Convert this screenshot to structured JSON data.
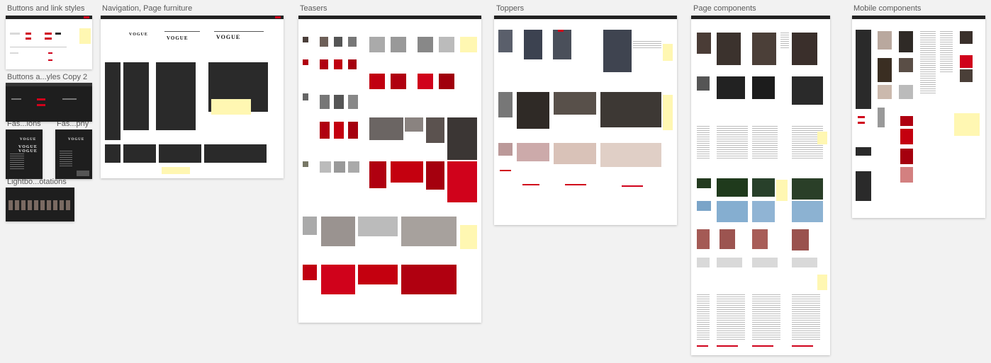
{
  "artboards": [
    {
      "title": "Buttons and link styles"
    },
    {
      "title": "Navigation, Page furniture"
    },
    {
      "title": "Teasers"
    },
    {
      "title": "Toppers"
    },
    {
      "title": "Page components"
    },
    {
      "title": "Mobile components"
    },
    {
      "title": "Buttons a...yles Copy 2"
    },
    {
      "title": "Fas...ions"
    },
    {
      "title": "Fas...phy"
    },
    {
      "title": "Lightbo...otations"
    }
  ],
  "colors": {
    "canvas": "#f2f2f2",
    "board": "#ffffff",
    "dark_board": "#1e1e1e",
    "accent_red": "#d0021b",
    "sticky_note": "#fff7b2"
  }
}
